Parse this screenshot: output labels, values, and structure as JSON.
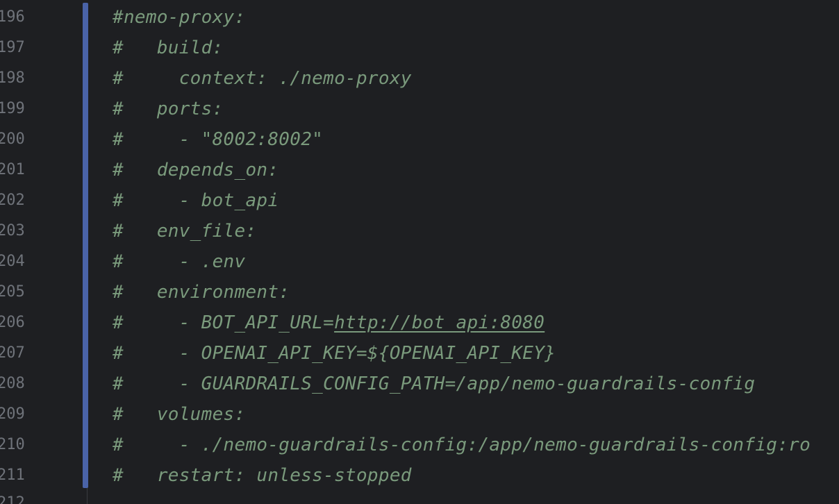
{
  "editor": {
    "lines": [
      {
        "number": "196",
        "text": "#nemo-proxy:"
      },
      {
        "number": "197",
        "text": "#   build:"
      },
      {
        "number": "198",
        "text": "#     context: ./nemo-proxy"
      },
      {
        "number": "199",
        "text": "#   ports:"
      },
      {
        "number": "200",
        "text": "#     - \"8002:8002\""
      },
      {
        "number": "201",
        "text": "#   depends_on:"
      },
      {
        "number": "202",
        "text": "#     - bot_api"
      },
      {
        "number": "203",
        "text": "#   env_file:"
      },
      {
        "number": "204",
        "text": "#     - .env"
      },
      {
        "number": "205",
        "text": "#   environment:"
      },
      {
        "number": "206",
        "text_before": "#     - BOT_API_URL=",
        "link": "http://bot_api:8080"
      },
      {
        "number": "207",
        "text": "#     - OPENAI_API_KEY=${OPENAI_API_KEY}"
      },
      {
        "number": "208",
        "text": "#     - GUARDRAILS_CONFIG_PATH=/app/nemo-guardrails-config"
      },
      {
        "number": "209",
        "text": "#   volumes:"
      },
      {
        "number": "210",
        "text": "#     - ./nemo-guardrails-config:/app/nemo-guardrails-config:ro"
      },
      {
        "number": "211",
        "text": "#   restart: unless-stopped"
      }
    ],
    "partial_line_number": "212"
  },
  "colors": {
    "background": "#1e1f22",
    "comment": "#7a9a7c",
    "line_number": "#6f737a",
    "change_marker": "#4a63a8"
  }
}
